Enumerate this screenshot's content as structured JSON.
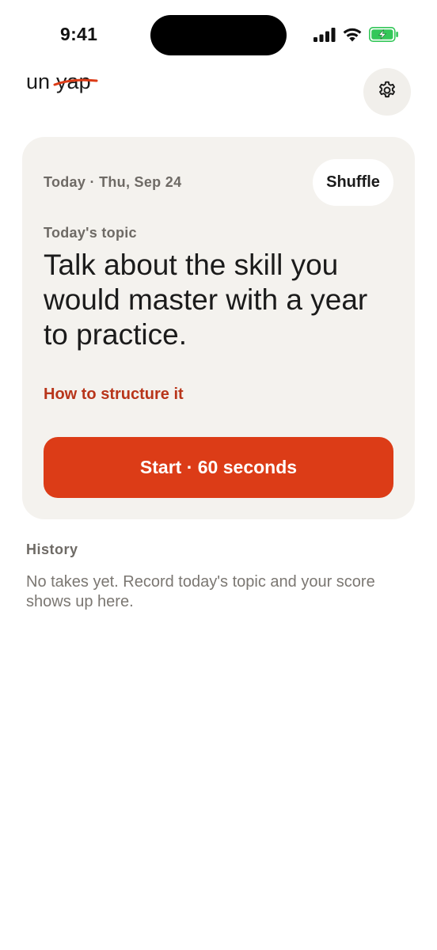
{
  "status_bar": {
    "time": "9:41",
    "icons": [
      "cellular-signal-icon",
      "wifi-icon",
      "battery-charging-icon"
    ],
    "battery_color": "#34c759"
  },
  "header": {
    "logo_word_1": "un",
    "logo_word_2": "yap",
    "logo_strike_color": "#dc3c17",
    "settings_icon": "gear-icon"
  },
  "card": {
    "date": "Today · Thu, Sep 24",
    "shuffle_label": "Shuffle",
    "topic_label": "Today's topic",
    "topic_text": "Talk about the skill you would master with a year to practice.",
    "structure_link": "How to structure it",
    "start_label": "Start · 60 seconds",
    "accent": "#dc3c17",
    "link_color": "#b8351a",
    "background": "#f4f2ee"
  },
  "history": {
    "title": "History",
    "empty_text": "No takes yet. Record today's topic and your score shows up here."
  }
}
